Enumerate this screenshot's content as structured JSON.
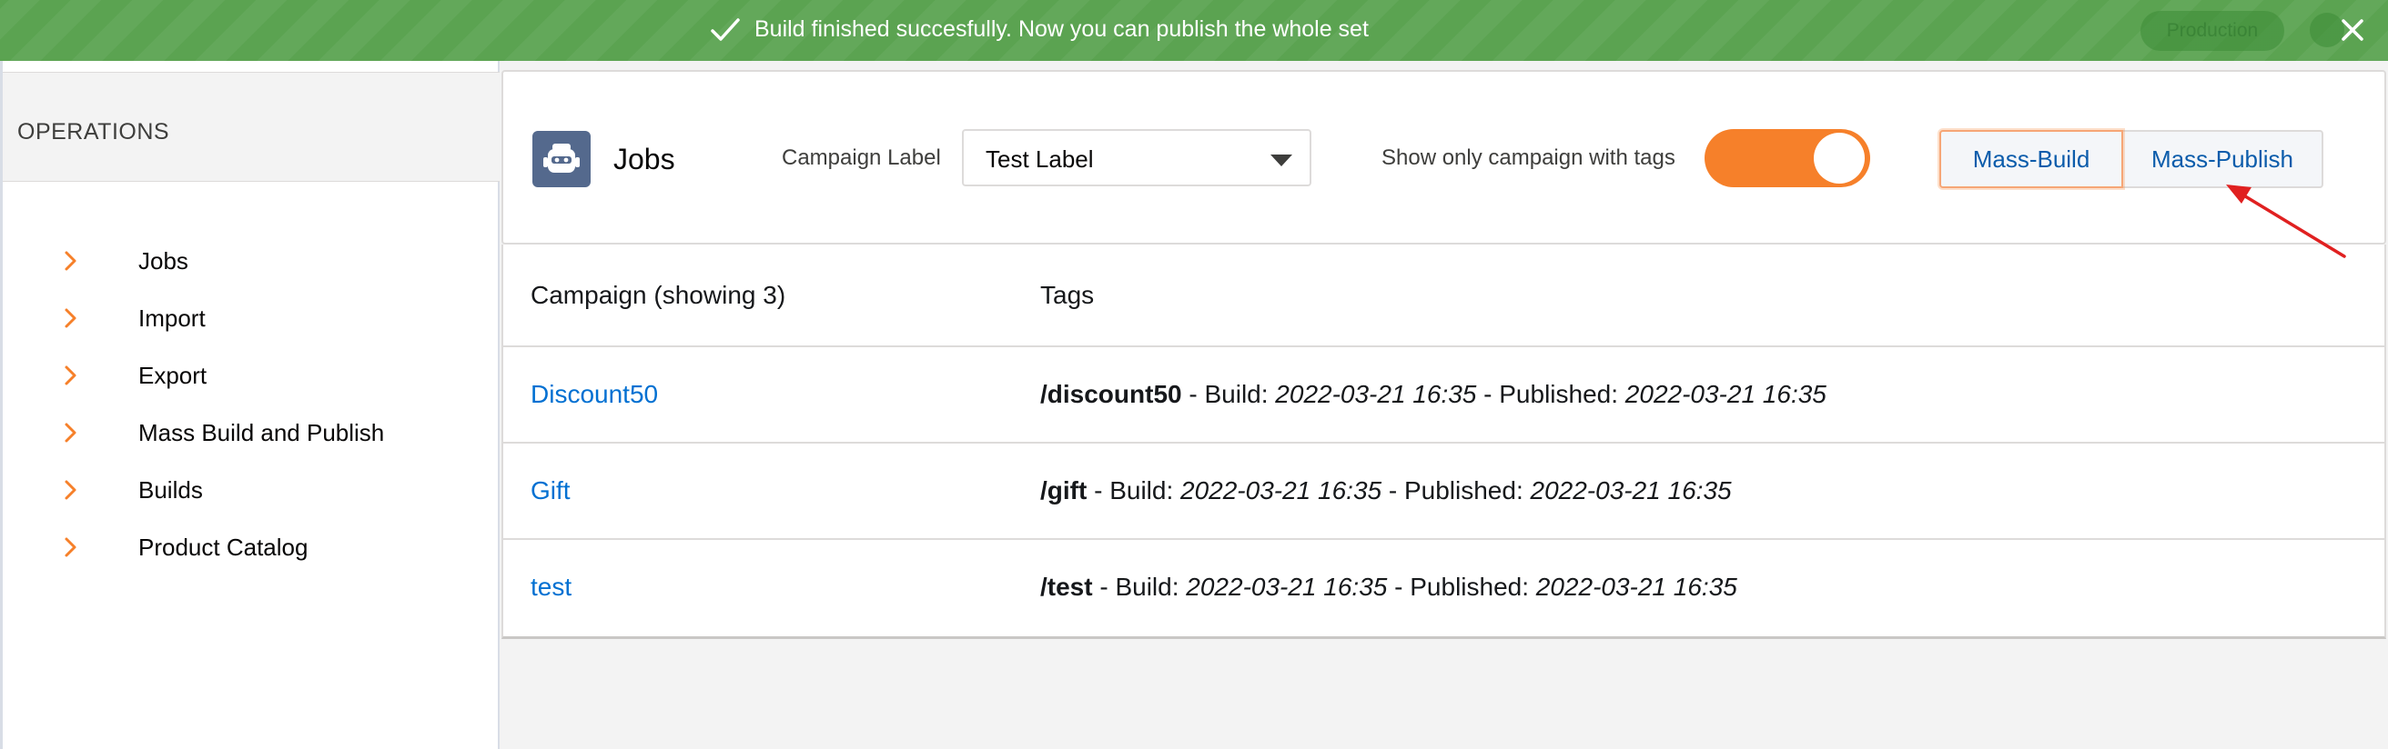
{
  "toast": {
    "message": "Build finished succesfully. Now you can publish the whole set",
    "environment_badge": "Production",
    "icon": "check-icon",
    "close_icon": "close-icon",
    "color": "#5ba351"
  },
  "sidebar": {
    "title": "OPERATIONS",
    "items": [
      {
        "label": "Jobs"
      },
      {
        "label": "Import"
      },
      {
        "label": "Export"
      },
      {
        "label": "Mass Build and Publish"
      },
      {
        "label": "Builds"
      },
      {
        "label": "Product Catalog"
      }
    ],
    "chevron_color": "#f6802a"
  },
  "header": {
    "title": "Jobs",
    "icon": "robot-icon",
    "campaign_label": "Campaign Label",
    "campaign_value": "Test Label",
    "toggle_label": "Show only campaign with tags",
    "toggle_on": true,
    "toggle_color": "#f6802a",
    "buttons": {
      "mass_build": "Mass-Build",
      "mass_publish": "Mass-Publish"
    }
  },
  "table": {
    "columns": [
      "Campaign (showing 3)",
      "Tags"
    ],
    "rows": [
      {
        "campaign": "Discount50",
        "tag": "/discount50",
        "build_label": " - Build: ",
        "build_time": "2022-03-21 16:35",
        "published_label": " - Published: ",
        "published_time": "2022-03-21 16:35"
      },
      {
        "campaign": "Gift",
        "tag": "/gift",
        "build_label": " - Build: ",
        "build_time": "2022-03-21 16:35",
        "published_label": " - Published: ",
        "published_time": "2022-03-21 16:35"
      },
      {
        "campaign": "test",
        "tag": "/test",
        "build_label": " - Build: ",
        "build_time": "2022-03-21 16:35",
        "published_label": " - Published: ",
        "published_time": "2022-03-21 16:35"
      }
    ],
    "link_color": "#0070d2"
  },
  "annotation": {
    "arrow_color": "#e02020"
  }
}
